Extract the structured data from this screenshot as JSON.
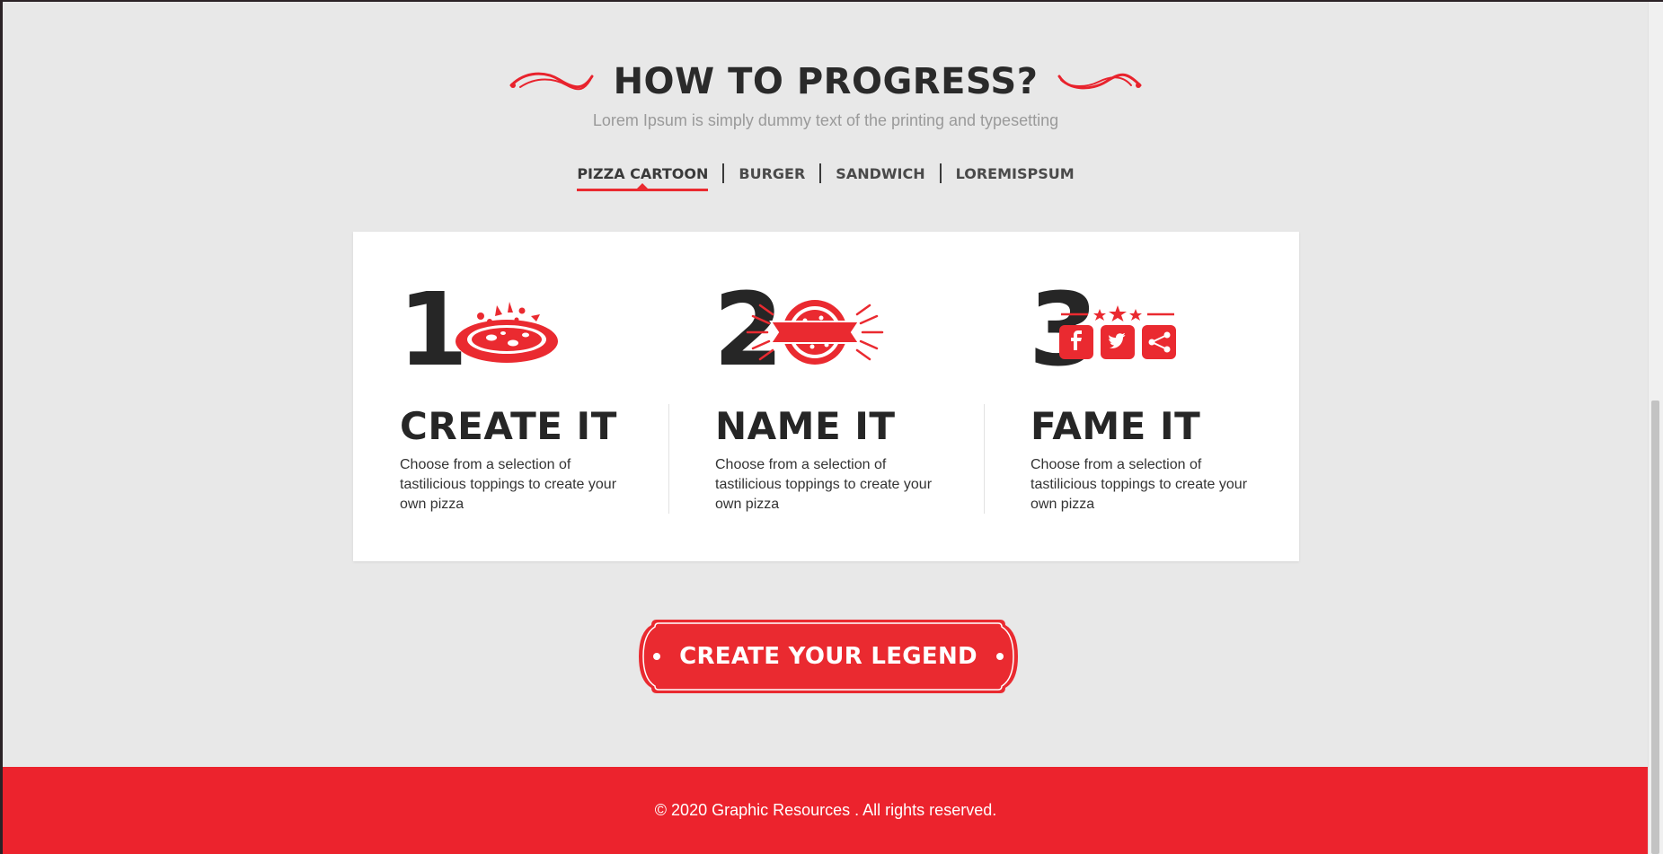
{
  "section": {
    "title": "HOW TO PROGRESS?",
    "subtitle": "Lorem Ipsum is simply dummy text of the printing and typesetting"
  },
  "tabs": [
    {
      "label": "PIZZA CARTOON",
      "active": true
    },
    {
      "label": "BURGER",
      "active": false
    },
    {
      "label": "SANDWICH",
      "active": false
    },
    {
      "label": "LOREMISPSUM",
      "active": false
    }
  ],
  "steps": [
    {
      "number": "1",
      "title": "CREATE IT",
      "description": "Choose from a selection of tastilicious toppings to create your own pizza",
      "icon": "pizza-icon"
    },
    {
      "number": "2",
      "title": "NAME IT",
      "description": "Choose from a selection of tastilicious toppings to create your own pizza",
      "icon": "pizza-badge-icon"
    },
    {
      "number": "3",
      "title": "FAME IT",
      "description": "Choose from a selection of tastilicious toppings to create your own pizza",
      "icon": "social-share-icon"
    }
  ],
  "cta": {
    "label": "CREATE YOUR LEGEND"
  },
  "footer": {
    "copyright": "© 2020 Graphic Resources . All rights reserved."
  },
  "colors": {
    "accent": "#ec232d",
    "background": "#e8e8e8",
    "text_dark": "#262626"
  }
}
